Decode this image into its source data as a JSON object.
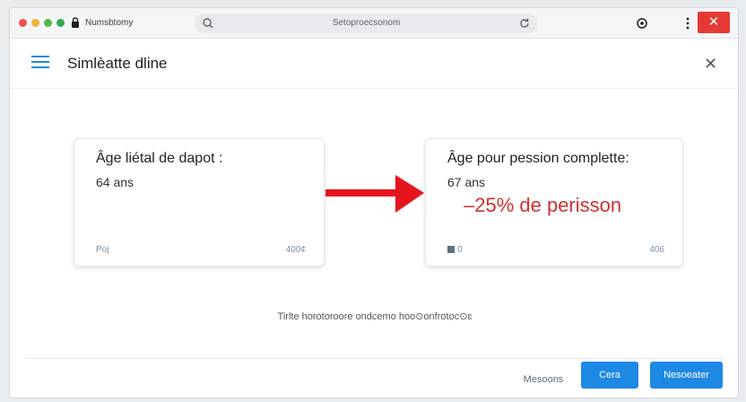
{
  "browser": {
    "tab_title": "Numsbtomy",
    "url": "Setoproecsonom",
    "close_glyph": "✕"
  },
  "header": {
    "title": "Simlèatte dline",
    "close_glyph": "✕"
  },
  "cards": [
    {
      "title": "Âge liétal de dapot :",
      "value": "64 ans",
      "highlight": "",
      "foot_left": "Poj",
      "foot_right": "400¢"
    },
    {
      "title": "Âge pour pession complette:",
      "value": "67 ans",
      "highlight": "–25% de perisson",
      "foot_left": "0",
      "foot_right": "406"
    }
  ],
  "info_text": "Tirlte horotoroore ondcemo hoo⊙onfrotoc⊙ɛ",
  "footer": {
    "text_button": "Mesoons",
    "button_one": "Cera",
    "button_two": "Nesoeater"
  },
  "colors": {
    "accent": "#1e88e5",
    "arrow": "#e5141e",
    "highlight": "#d32f2f",
    "close": "#e53935"
  }
}
